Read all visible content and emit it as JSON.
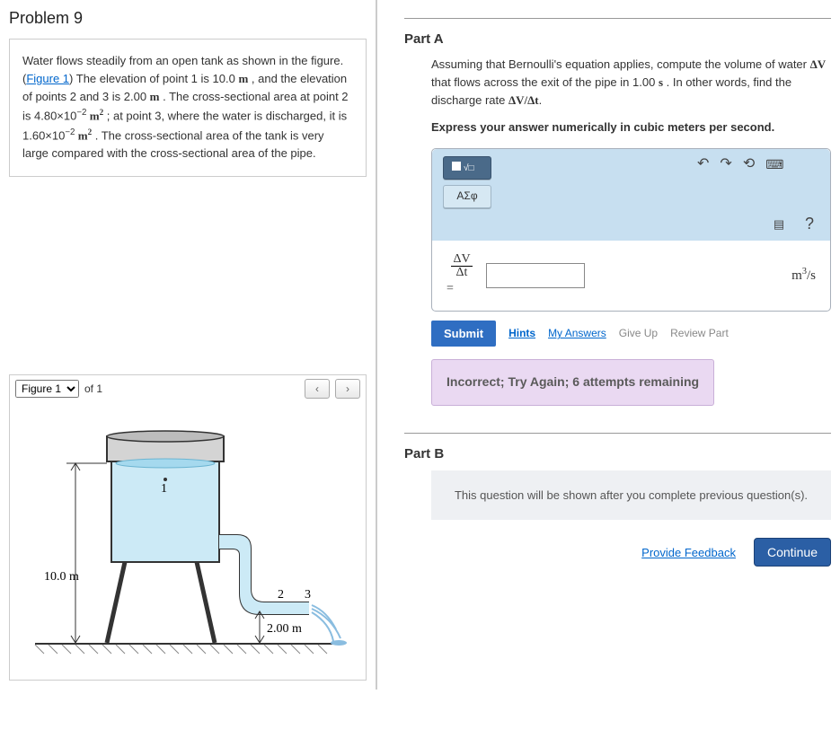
{
  "problem": {
    "title": "Problem 9",
    "text_before_figlink": "Water flows steadily from an open tank as shown in the figure. (",
    "fig_link": "Figure 1",
    "text_pt1": ") The elevation of point 1 is 10.0 ",
    "unit_m1": "m",
    "text_pt2": " , and the elevation of points 2 and 3 is 2.00 ",
    "unit_m2": "m",
    "text_pt3": " . The cross-sectional area at point 2 is 4.80×10",
    "exp1": "−2",
    "unit_m2sq": " m",
    "sq1": "2",
    "text_pt4": " ; at point 3, where the water is discharged, it is 1.60×10",
    "exp2": "−2",
    "unit_m3sq": " m",
    "sq2": "2",
    "text_pt5": " . The cross-sectional area of the tank is very large compared with the cross-sectional area of the pipe."
  },
  "figure": {
    "selected": "Figure 1",
    "of_text": "of 1",
    "labels": {
      "p1": "1",
      "p2": "2",
      "p3": "3",
      "h1": "10.0 m",
      "h2": "2.00 m"
    }
  },
  "partA": {
    "title": "Part A",
    "prompt1": "Assuming that Bernoulli's equation applies, compute the volume of water ",
    "dv": "ΔV",
    "prompt2": " that flows across the exit of the pipe in 1.00 ",
    "unit_s": "s",
    "prompt3": " . In other words, find the discharge rate ",
    "rate": "ΔV/Δt",
    "prompt4": ".",
    "instruction": "Express your answer numerically in cubic meters per second.",
    "toolbar": {
      "greek": "ΑΣφ"
    },
    "lhs_top": "ΔV",
    "lhs_bot": "Δt",
    "lhs_eq": "=",
    "answer_value": "",
    "units_html": "m³/s",
    "submit": "Submit",
    "hints": "Hints",
    "my_answers": "My Answers",
    "give_up": "Give Up",
    "review": "Review Part",
    "feedback": "Incorrect; Try Again; 6 attempts remaining"
  },
  "partB": {
    "title": "Part B",
    "msg": "This question will be shown after you complete previous question(s)."
  },
  "footer": {
    "feedback_link": "Provide Feedback",
    "continue": "Continue"
  }
}
